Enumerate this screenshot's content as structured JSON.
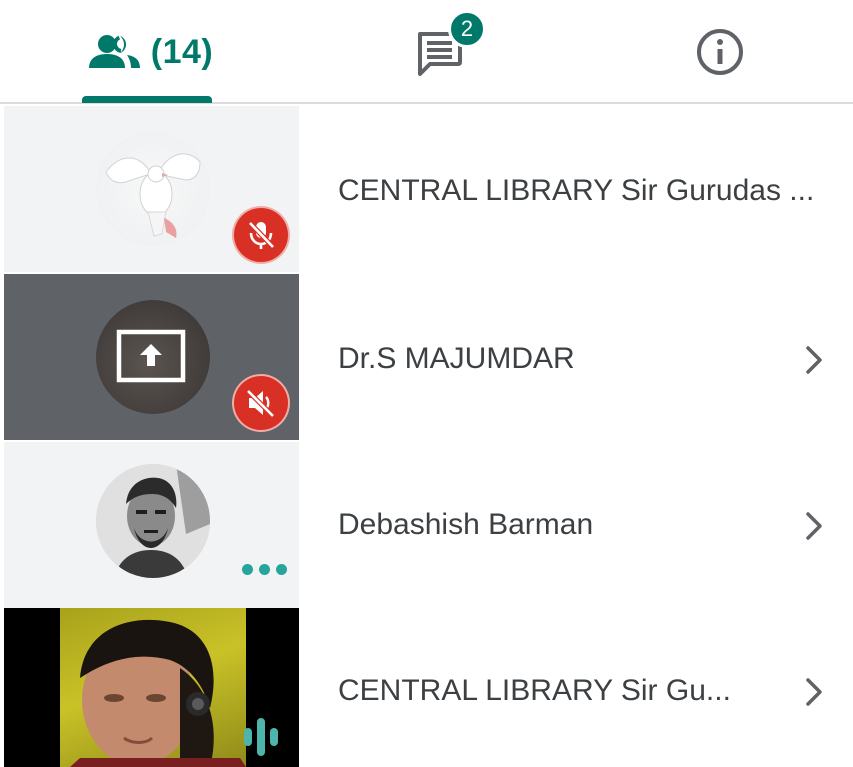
{
  "tabs": {
    "people": {
      "icon": "people-icon",
      "count_label": "(14)",
      "selected": true
    },
    "chat": {
      "icon": "chat-icon",
      "badge": "2"
    },
    "info": {
      "icon": "info-icon"
    }
  },
  "participants": [
    {
      "name": "CENTRAL LIBRARY Sir Gurudas ...",
      "avatar": "dove-photo",
      "status_icon": "mic-off-icon",
      "has_chevron": false
    },
    {
      "name": "Dr.S MAJUMDAR",
      "avatar": "screen-share-icon",
      "status_icon": "volume-off-icon",
      "has_chevron": true
    },
    {
      "name": "Debashish Barman",
      "avatar": "profile-photo",
      "status_icon": "more-dots-icon",
      "has_chevron": true
    },
    {
      "name": "CENTRAL LIBRARY Sir Gu...",
      "avatar": "live-video",
      "status_icon": "speaking-icon",
      "has_chevron": true
    }
  ],
  "colors": {
    "accent": "#00796b",
    "muted_red": "#d93025",
    "speaking_teal": "#26a69a",
    "text": "#3c4043"
  }
}
